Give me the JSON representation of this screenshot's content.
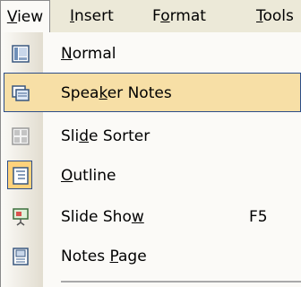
{
  "menubar": {
    "view": "View",
    "insert": "Insert",
    "format": "Format",
    "tools": "Tools"
  },
  "menu": {
    "items": [
      {
        "label": "Normal",
        "icon": "normal-view-icon",
        "shortcut": ""
      },
      {
        "label": "Speaker Notes",
        "icon": "speaker-notes-icon",
        "shortcut": "",
        "highlighted": true
      },
      {
        "label": "Slide Sorter",
        "icon": "slide-sorter-icon",
        "shortcut": ""
      },
      {
        "label": "Outline",
        "icon": "outline-view-icon",
        "shortcut": "",
        "checked": true
      },
      {
        "label": "Slide Show",
        "icon": "slide-show-icon",
        "shortcut": "F5"
      },
      {
        "label": "Notes Page",
        "icon": "notes-page-icon",
        "shortcut": ""
      }
    ]
  },
  "colors": {
    "highlight": "#f7dfa6",
    "highlight_border": "#2d4e8a",
    "menu_bg": "#fbfaf7",
    "menubar_bg": "#ece9d8"
  }
}
